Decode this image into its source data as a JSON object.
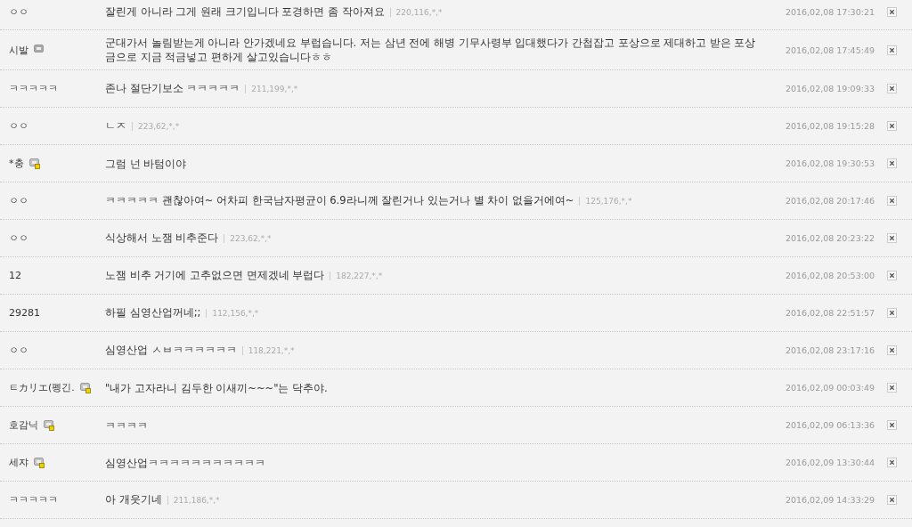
{
  "comments": [
    {
      "name": "ㅇㅇ",
      "gallog": false,
      "text": "잘린게 아니라 그게 원래 크기입니다 포경하면 좀 작아져요",
      "ip": "220,116,*,*",
      "date": "2016,02,08 17:30:21"
    },
    {
      "name": "시발",
      "gallog": true,
      "fixed": false,
      "text": "군대가서 놀림받는게 아니라 안가겠네요 부럽습니다. 저는 삼년 전에 해병 기무사령부 입대했다가 간첩잡고 포상으로 제대하고 받은 포상금으로 지금 적금넣고 편하게 살고있습니다ㅎㅎ",
      "date": "2016,02,08 17:45:49"
    },
    {
      "name": "ㅋㅋㅋㅋㅋ",
      "gallog": false,
      "text": "존나 절단기보소 ㅋㅋㅋㅋㅋ",
      "ip": "211,199,*,*",
      "date": "2016,02,08 19:09:33"
    },
    {
      "name": "ㅇㅇ",
      "gallog": false,
      "text": "ㄴㅈ",
      "ip": "223,62,*,*",
      "date": "2016,02,08 19:15:28"
    },
    {
      "name": "*충",
      "gallog": true,
      "fixed": true,
      "text": "그럼 넌 바텀이야",
      "date": "2016,02,08 19:30:53"
    },
    {
      "name": "ㅇㅇ",
      "gallog": false,
      "text": "ㅋㅋㅋㅋㅋ 괜찮아여~ 어차피 한국남자평균이 6.9라니께 잘린거나 있는거나 별 차이 없을거에여~",
      "ip": "125,176,*,*",
      "date": "2016,02,08 20:17:46"
    },
    {
      "name": "ㅇㅇ",
      "gallog": false,
      "text": "식상해서 노잼 비추준다",
      "ip": "223,62,*,*",
      "date": "2016,02,08 20:23:22"
    },
    {
      "name": "12",
      "gallog": false,
      "text": "노잼 비추 거기에 고추없으면 면제겠네 부럽다",
      "ip": "182,227,*,*",
      "date": "2016,02,08 20:53:00"
    },
    {
      "name": "29281",
      "gallog": false,
      "text": "하필 심영산업꺼네;;",
      "ip": "112,156,*,*",
      "date": "2016,02,08 22:51:57"
    },
    {
      "name": "ㅇㅇ",
      "gallog": false,
      "text": "심영산업 ㅅㅂㅋㅋㅋㅋㅋㅋ",
      "ip": "118,221,*,*",
      "date": "2016,02,08 23:17:16"
    },
    {
      "name": "ㅌカリエ(펭긴.",
      "gallog": true,
      "fixed": true,
      "text": "\"내가 고자라니 김두한 이새끼~~~\"는 닥추야.",
      "date": "2016,02,09 00:03:49"
    },
    {
      "name": "호감닉",
      "gallog": true,
      "fixed": true,
      "text": "ㅋㅋㅋㅋ",
      "date": "2016,02,09 06:13:36"
    },
    {
      "name": "세쟈",
      "gallog": true,
      "fixed": true,
      "text": "심영산업ㅋㅋㅋㅋㅋㅋㅋㅋㅋㅋㅋ",
      "date": "2016,02,09 13:30:44"
    },
    {
      "name": "ㅋㅋㅋㅋㅋ",
      "gallog": false,
      "text": "아 개웃기네",
      "ip": "211,186,*,*",
      "date": "2016,02,09 14:33:29"
    }
  ]
}
